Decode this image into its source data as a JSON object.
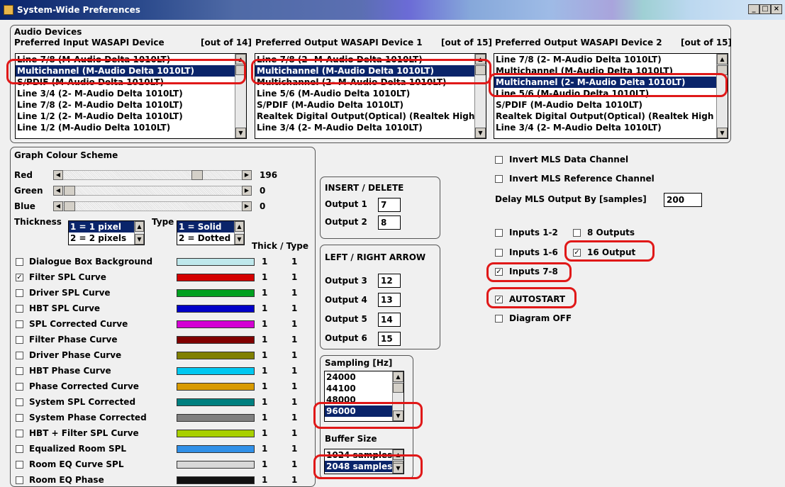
{
  "window": {
    "title": "System-Wide Preferences",
    "controls": [
      "_",
      "□",
      "×"
    ]
  },
  "audio": {
    "heading": "Audio Devices",
    "input": {
      "label": "Preferred Input WASAPI Device",
      "count": "[out of 14]",
      "items": [
        "Line 7/8 (M-Audio Delta 1010LT)",
        "Multichannel (M-Audio Delta 1010LT)",
        "S/PDIF (M-Audio Delta 1010LT)",
        "Line 3/4 (2- M-Audio Delta 1010LT)",
        "Line 7/8 (2- M-Audio Delta 1010LT)",
        "Line 1/2 (2- M-Audio Delta 1010LT)",
        "Line 1/2 (M-Audio Delta 1010LT)"
      ],
      "selected": 1
    },
    "output1": {
      "label": "Preferred Output WASAPI Device 1",
      "count": "[out of 15]",
      "items": [
        "Line 7/8 (2- M-Audio Delta 1010LT)",
        "Multichannel (M-Audio Delta 1010LT)",
        "Multichannel (2- M-Audio Delta 1010LT)",
        "Line 5/6 (M-Audio Delta 1010LT)",
        "S/PDIF (M-Audio Delta 1010LT)",
        "Realtek Digital Output(Optical) (Realtek High",
        "Line 3/4 (2- M-Audio Delta 1010LT)"
      ],
      "selected": 1
    },
    "output2": {
      "label": "Preferred Output WASAPI Device 2",
      "count": "[out of 15]",
      "items": [
        "Line 7/8 (2- M-Audio Delta 1010LT)",
        "Multichannel (M-Audio Delta 1010LT)",
        "Multichannel (2- M-Audio Delta 1010LT)",
        "Line 5/6 (M-Audio Delta 1010LT)",
        "S/PDIF (M-Audio Delta 1010LT)",
        "Realtek Digital Output(Optical) (Realtek High",
        "Line 3/4 (2- M-Audio Delta 1010LT)"
      ],
      "selected": 2
    }
  },
  "graph": {
    "heading": "Graph Colour Scheme",
    "red": {
      "label": "Red",
      "value": "196",
      "level": 0.77
    },
    "green": {
      "label": "Green",
      "value": "0",
      "level": 0
    },
    "blue": {
      "label": "Blue",
      "value": "0",
      "level": 0
    },
    "thickness_label": "Thickness",
    "thickness_options": [
      "1 = 1 pixel",
      "2 = 2 pixels"
    ],
    "type_label": "Type",
    "type_options": [
      "1 = Solid",
      "2 = Dotted"
    ],
    "thick_type_header": "Thick / Type",
    "curves": [
      {
        "label": "Dialogue Box Background",
        "checked": false,
        "color": "#bfe8ec",
        "thick": "1",
        "type": "1"
      },
      {
        "label": "Filter SPL Curve",
        "checked": true,
        "color": "#d40000",
        "thick": "1",
        "type": "1"
      },
      {
        "label": "Driver SPL Curve",
        "checked": false,
        "color": "#00a020",
        "thick": "1",
        "type": "1"
      },
      {
        "label": "HBT SPL Curve",
        "checked": false,
        "color": "#0000c8",
        "thick": "1",
        "type": "1"
      },
      {
        "label": "SPL Corrected Curve",
        "checked": false,
        "color": "#d400d4",
        "thick": "1",
        "type": "1"
      },
      {
        "label": "Filter Phase Curve",
        "checked": false,
        "color": "#800000",
        "thick": "1",
        "type": "1"
      },
      {
        "label": "Driver Phase Curve",
        "checked": false,
        "color": "#808000",
        "thick": "1",
        "type": "1"
      },
      {
        "label": "HBT Phase Curve",
        "checked": false,
        "color": "#00c8f0",
        "thick": "1",
        "type": "1"
      },
      {
        "label": "Phase Corrected Curve",
        "checked": false,
        "color": "#d89a00",
        "thick": "1",
        "type": "1"
      },
      {
        "label": "System SPL Corrected",
        "checked": false,
        "color": "#008080",
        "thick": "1",
        "type": "1"
      },
      {
        "label": "System Phase Corrected",
        "checked": false,
        "color": "#808080",
        "thick": "1",
        "type": "1"
      },
      {
        "label": "HBT + Filter SPL Curve",
        "checked": false,
        "color": "#a8d000",
        "thick": "1",
        "type": "1"
      },
      {
        "label": "Equalized Room SPL",
        "checked": false,
        "color": "#3090e8",
        "thick": "1",
        "type": "1"
      },
      {
        "label": "Room EQ Curve SPL",
        "checked": false,
        "color": "#d8d8d8",
        "thick": "1",
        "type": "1"
      },
      {
        "label": "Room EQ Phase",
        "checked": false,
        "color": "#101010",
        "thick": "1",
        "type": "1"
      }
    ]
  },
  "insert_delete": {
    "heading": "INSERT / DELETE",
    "rows": [
      {
        "label": "Output 1",
        "value": "7"
      },
      {
        "label": "Output 2",
        "value": "8"
      }
    ]
  },
  "left_right": {
    "heading": "LEFT / RIGHT ARROW",
    "rows": [
      {
        "label": "Output 3",
        "value": "12"
      },
      {
        "label": "Output 4",
        "value": "13"
      },
      {
        "label": "Output 5",
        "value": "14"
      },
      {
        "label": "Output 6",
        "value": "15"
      }
    ]
  },
  "sampling": {
    "label": "Sampling [Hz]",
    "items": [
      "24000",
      "44100",
      "48000",
      "96000"
    ],
    "selected": 3
  },
  "buffer": {
    "label": "Buffer Size",
    "items": [
      "1024 samples",
      "2048 samples"
    ],
    "selected": 1
  },
  "options": {
    "invert_data": {
      "label": "Invert MLS Data Channel",
      "checked": false
    },
    "invert_ref": {
      "label": "Invert MLS Reference Channel",
      "checked": false
    },
    "delay_label": "Delay MLS Output By [samples]",
    "delay_value": "200",
    "inputs_12": {
      "label": "Inputs 1-2",
      "checked": false
    },
    "outputs_8": {
      "label": "8 Outputs",
      "checked": false
    },
    "inputs_16": {
      "label": "Inputs 1-6",
      "checked": false
    },
    "outputs_16": {
      "label": "16 Output",
      "checked": true
    },
    "inputs_78": {
      "label": "Inputs 7-8",
      "checked": true
    },
    "autostart": {
      "label": "AUTOSTART",
      "checked": true
    },
    "diagram_off": {
      "label": "Diagram OFF",
      "checked": false
    }
  }
}
